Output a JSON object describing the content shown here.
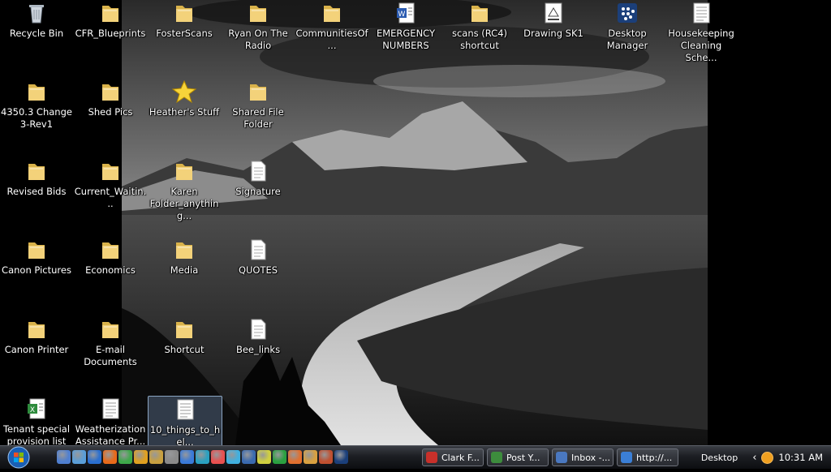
{
  "desktop": {
    "icons": [
      {
        "label": "Recycle Bin",
        "type": "recycle"
      },
      {
        "label": "CFR_Blueprints",
        "type": "folder"
      },
      {
        "label": "FosterScans",
        "type": "folder"
      },
      {
        "label": "Ryan On The Radio",
        "type": "folder"
      },
      {
        "label": "CommunitiesOf...",
        "type": "folder"
      },
      {
        "label": "EMERGENCY NUMBERS",
        "type": "word"
      },
      {
        "label": "scans (RC4) shortcut",
        "type": "folder"
      },
      {
        "label": "Drawing SK1",
        "type": "drawing"
      },
      {
        "label": "Desktop Manager",
        "type": "blackberry"
      },
      {
        "label": "Housekeeping Cleaning Sche...",
        "type": "doc"
      },
      {
        "label": "4350.3 Change 3-Rev1",
        "type": "folder"
      },
      {
        "label": "Shed Pics",
        "type": "folder"
      },
      {
        "label": "Heather's Stuff",
        "type": "star"
      },
      {
        "label": "Shared File Folder",
        "type": "folder"
      },
      {
        "label": "Revised Bids",
        "type": "folder"
      },
      {
        "label": "Current_Waitin...",
        "type": "folder"
      },
      {
        "label": "Karen Folder_anything...",
        "type": "folder"
      },
      {
        "label": "Signature",
        "type": "text"
      },
      {
        "label": "Canon Pictures",
        "type": "folder"
      },
      {
        "label": "Economics",
        "type": "folder"
      },
      {
        "label": "Media",
        "type": "folder"
      },
      {
        "label": "QUOTES",
        "type": "text"
      },
      {
        "label": "Canon Printer",
        "type": "folder"
      },
      {
        "label": "E-mail Documents",
        "type": "folder"
      },
      {
        "label": "Shortcut",
        "type": "folder"
      },
      {
        "label": "Bee_links",
        "type": "text"
      },
      {
        "label": "Tenant special provision list",
        "type": "excel"
      },
      {
        "label": "Weatherization Assistance Pr...",
        "type": "doc"
      },
      {
        "label": "10_things_to_hel...",
        "type": "doc"
      }
    ]
  },
  "taskbar": {
    "tasks": [
      {
        "label": "Clark F...",
        "color": "#c8302a"
      },
      {
        "label": "Post Y...",
        "color": "#3d8c3d"
      },
      {
        "label": "Inbox -...",
        "color": "#4a78c0"
      },
      {
        "label": "http://...",
        "color": "#3b7fd6"
      }
    ],
    "desktop_label": "Desktop",
    "clock": "10:31 AM"
  }
}
